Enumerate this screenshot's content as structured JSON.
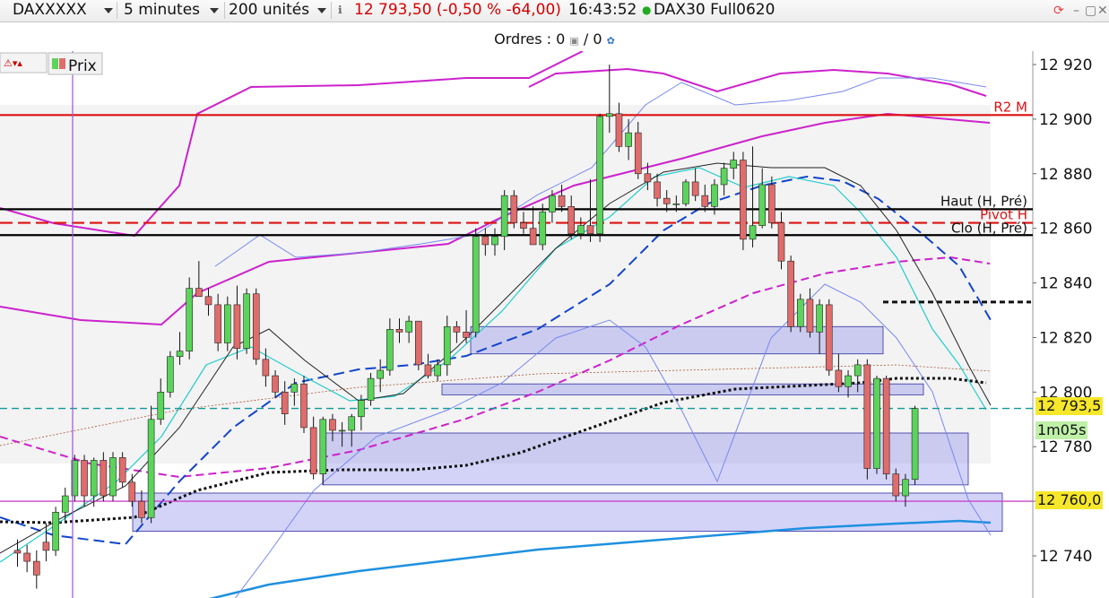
{
  "toolbar": {
    "symbol": "DAXXXXX",
    "interval": "5 minutes",
    "units": "200 unités",
    "quote": "12 793,50 (-0,50 % -64,00)",
    "time": "16:43:52",
    "instrument": "DAX30 Full0620",
    "quote_color": "#d40000",
    "status_color": "#22aa22"
  },
  "orders": {
    "label": "Ordres : 0",
    "suffix": "/ 0"
  },
  "legend": {
    "label": "Prix"
  },
  "tags": {
    "last_price": "12 793,5",
    "countdown": "1m05s",
    "cursor_price": "12 760,0"
  },
  "chart_data": {
    "type": "candlestick",
    "ylim": [
      12732,
      12924
    ],
    "yticks": [
      "12 740",
      "12 760",
      "12 780",
      "12 800",
      "12 820",
      "12 840",
      "12 860",
      "12 880",
      "12 900",
      "12 920"
    ],
    "yticks_values": [
      12740,
      12760,
      12780,
      12800,
      12820,
      12840,
      12860,
      12880,
      12900,
      12920
    ],
    "levels": [
      {
        "label": "R2 M",
        "value": 12901.5,
        "color": "#dd1111",
        "style": "solid"
      },
      {
        "label": "Haut (H, Pré)",
        "value": 12867,
        "color": "#000000",
        "style": "solid"
      },
      {
        "label": "Pivot H",
        "value": 12862,
        "color": "#dd1111",
        "style": "dashed"
      },
      {
        "label": "Clo (H, Pré)",
        "value": 12857.5,
        "color": "#000000",
        "style": "solid"
      },
      {
        "label": "",
        "value": 12794,
        "color": "#119999",
        "style": "dashed"
      },
      {
        "label": "",
        "value": 12760,
        "color": "#cc44cc",
        "style": "solid"
      }
    ],
    "candles": [
      [
        12742,
        12746,
        12736,
        12741
      ],
      [
        12741,
        12744,
        12734,
        12738
      ],
      [
        12738,
        12742,
        12728,
        12733
      ],
      [
        12745,
        12752,
        12738,
        12742
      ],
      [
        12742,
        12758,
        12740,
        12756
      ],
      [
        12756,
        12765,
        12752,
        12762
      ],
      [
        12762,
        12777,
        12760,
        12775
      ],
      [
        12775,
        12777,
        12758,
        12762
      ],
      [
        12762,
        12776,
        12758,
        12775
      ],
      [
        12775,
        12778,
        12760,
        12762
      ],
      [
        12762,
        12778,
        12760,
        12776
      ],
      [
        12776,
        12778,
        12765,
        12767
      ],
      [
        12767,
        12770,
        12758,
        12760
      ],
      [
        12760,
        12764,
        12752,
        12754
      ],
      [
        12754,
        12795,
        12752,
        12790
      ],
      [
        12790,
        12805,
        12788,
        12800
      ],
      [
        12800,
        12815,
        12798,
        12813
      ],
      [
        12813,
        12822,
        12810,
        12815
      ],
      [
        12815,
        12842,
        12812,
        12838
      ],
      [
        12838,
        12848,
        12835,
        12835
      ],
      [
        12835,
        12838,
        12828,
        12832
      ],
      [
        12832,
        12836,
        12815,
        12818
      ],
      [
        12818,
        12835,
        12815,
        12832
      ],
      [
        12832,
        12839,
        12812,
        12816
      ],
      [
        12816,
        12838,
        12814,
        12836
      ],
      [
        12836,
        12838,
        12810,
        12812
      ],
      [
        12812,
        12816,
        12802,
        12806
      ],
      [
        12806,
        12808,
        12798,
        12800
      ],
      [
        12800,
        12804,
        12788,
        12792
      ],
      [
        12800,
        12805,
        12795,
        12803
      ],
      [
        12803,
        12806,
        12785,
        12787
      ],
      [
        12787,
        12791,
        12768,
        12770
      ],
      [
        12770,
        12791,
        12766,
        12790
      ],
      [
        12790,
        12792,
        12782,
        12786
      ],
      [
        12786,
        12789,
        12780,
        12786
      ],
      [
        12786,
        12792,
        12780,
        12791
      ],
      [
        12791,
        12799,
        12786,
        12797
      ],
      [
        12797,
        12807,
        12795,
        12805
      ],
      [
        12805,
        12812,
        12800,
        12808
      ],
      [
        12808,
        12827,
        12806,
        12823
      ],
      [
        12823,
        12827,
        12818,
        12822
      ],
      [
        12822,
        12828,
        12818,
        12826
      ],
      [
        12826,
        12826,
        12808,
        12810
      ],
      [
        12810,
        12814,
        12805,
        12806
      ],
      [
        12806,
        12812,
        12804,
        12810
      ],
      [
        12810,
        12828,
        12806,
        12824
      ],
      [
        12824,
        12826,
        12818,
        12822
      ],
      [
        12822,
        12830,
        12818,
        12820
      ],
      [
        12822,
        12860,
        12820,
        12857
      ],
      [
        12857,
        12860,
        12850,
        12854
      ],
      [
        12854,
        12860,
        12850,
        12857
      ],
      [
        12857,
        12874,
        12852,
        12872
      ],
      [
        12872,
        12874,
        12860,
        12862
      ],
      [
        12862,
        12866,
        12858,
        12860
      ],
      [
        12860,
        12868,
        12854,
        12854
      ],
      [
        12854,
        12869,
        12852,
        12866
      ],
      [
        12866,
        12874,
        12862,
        12872
      ],
      [
        12872,
        12876,
        12866,
        12868
      ],
      [
        12868,
        12872,
        12856,
        12858
      ],
      [
        12858,
        12864,
        12856,
        12861
      ],
      [
        12861,
        12878,
        12855,
        12858
      ],
      [
        12858,
        12902,
        12855,
        12901
      ],
      [
        12901,
        12920,
        12895,
        12902
      ],
      [
        12902,
        12906,
        12888,
        12890
      ],
      [
        12890,
        12900,
        12885,
        12895
      ],
      [
        12895,
        12899,
        12878,
        12880
      ],
      [
        12880,
        12884,
        12874,
        12877
      ],
      [
        12877,
        12880,
        12868,
        12871
      ],
      [
        12871,
        12874,
        12866,
        12869
      ],
      [
        12869,
        12872,
        12866,
        12869
      ],
      [
        12869,
        12878,
        12868,
        12877
      ],
      [
        12877,
        12882,
        12870,
        12872
      ],
      [
        12872,
        12876,
        12866,
        12868
      ],
      [
        12868,
        12878,
        12865,
        12876
      ],
      [
        12876,
        12884,
        12872,
        12882
      ],
      [
        12882,
        12888,
        12878,
        12885
      ],
      [
        12885,
        12888,
        12852,
        12856
      ],
      [
        12856,
        12890,
        12853,
        12861
      ],
      [
        12861,
        12882,
        12860,
        12876
      ],
      [
        12876,
        12879,
        12860,
        12862
      ],
      [
        12862,
        12866,
        12845,
        12848
      ],
      [
        12848,
        12850,
        12822,
        12824
      ],
      [
        12824,
        12836,
        12822,
        12834
      ],
      [
        12834,
        12838,
        12820,
        12822
      ],
      [
        12822,
        12834,
        12814,
        12832
      ],
      [
        12832,
        12834,
        12806,
        12808
      ],
      [
        12808,
        12814,
        12800,
        12802
      ],
      [
        12802,
        12808,
        12798,
        12806
      ],
      [
        12806,
        12812,
        12800,
        12810
      ],
      [
        12810,
        12812,
        12768,
        12772
      ],
      [
        12772,
        12806,
        12770,
        12805
      ],
      [
        12805,
        12806,
        12768,
        12770
      ],
      [
        12770,
        12772,
        12760,
        12762
      ],
      [
        12762,
        12770,
        12758,
        12768
      ],
      [
        12768,
        12795,
        12766,
        12794
      ]
    ]
  }
}
